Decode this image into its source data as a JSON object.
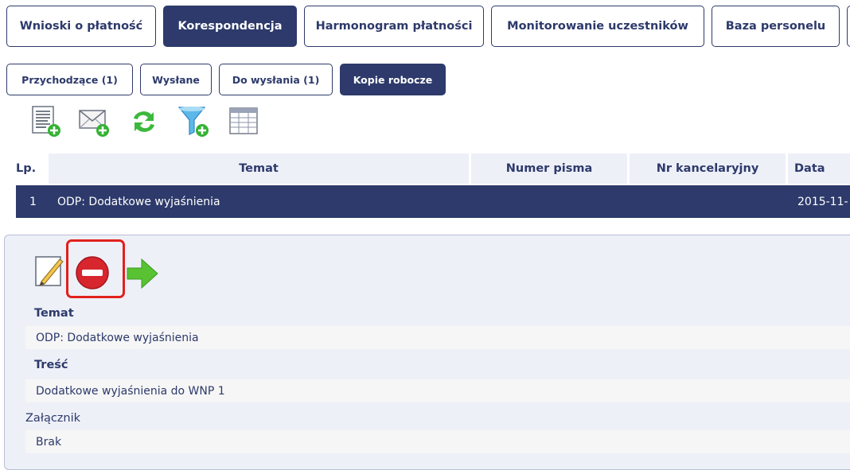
{
  "tabs": [
    {
      "label": "Wnioski o płatność",
      "active": false
    },
    {
      "label": "Korespondencja",
      "active": true
    },
    {
      "label": "Harmonogram płatności",
      "active": false
    },
    {
      "label": "Monitorowanie uczestników",
      "active": false
    },
    {
      "label": "Baza personelu",
      "active": false
    }
  ],
  "subtabs": [
    {
      "label": "Przychodzące (1)",
      "active": false
    },
    {
      "label": "Wysłane",
      "active": false
    },
    {
      "label": "Do wysłania (1)",
      "active": false
    },
    {
      "label": "Kopie robocze",
      "active": true
    }
  ],
  "toolbar": [
    "new-document-icon",
    "new-message-icon",
    "refresh-icon",
    "add-filter-icon",
    "table-columns-icon"
  ],
  "table": {
    "headers": [
      "Lp.",
      "Temat",
      "Numer pisma",
      "Nr kancelaryjny",
      "Data"
    ],
    "rows": [
      {
        "lp": "1",
        "temat": "ODP: Dodatkowe wyjaśnienia",
        "numer": "",
        "kancelaryjny": "",
        "data": "2015-11-"
      }
    ]
  },
  "detail": {
    "actions": [
      "edit-pencil-icon",
      "delete-icon",
      "send-arrow-icon"
    ],
    "temat_label": "Temat",
    "temat_value": "ODP: Dodatkowe wyjaśnienia",
    "tresc_label": "Treść",
    "tresc_value": "Dodatkowe wyjaśnienia do WNP 1",
    "zalacznik_label": "Załącznik",
    "zalacznik_value": "Brak"
  },
  "colors": {
    "navy": "#2d3a6b",
    "highlight": "#e0211c",
    "light_panel": "#eef0f8"
  }
}
